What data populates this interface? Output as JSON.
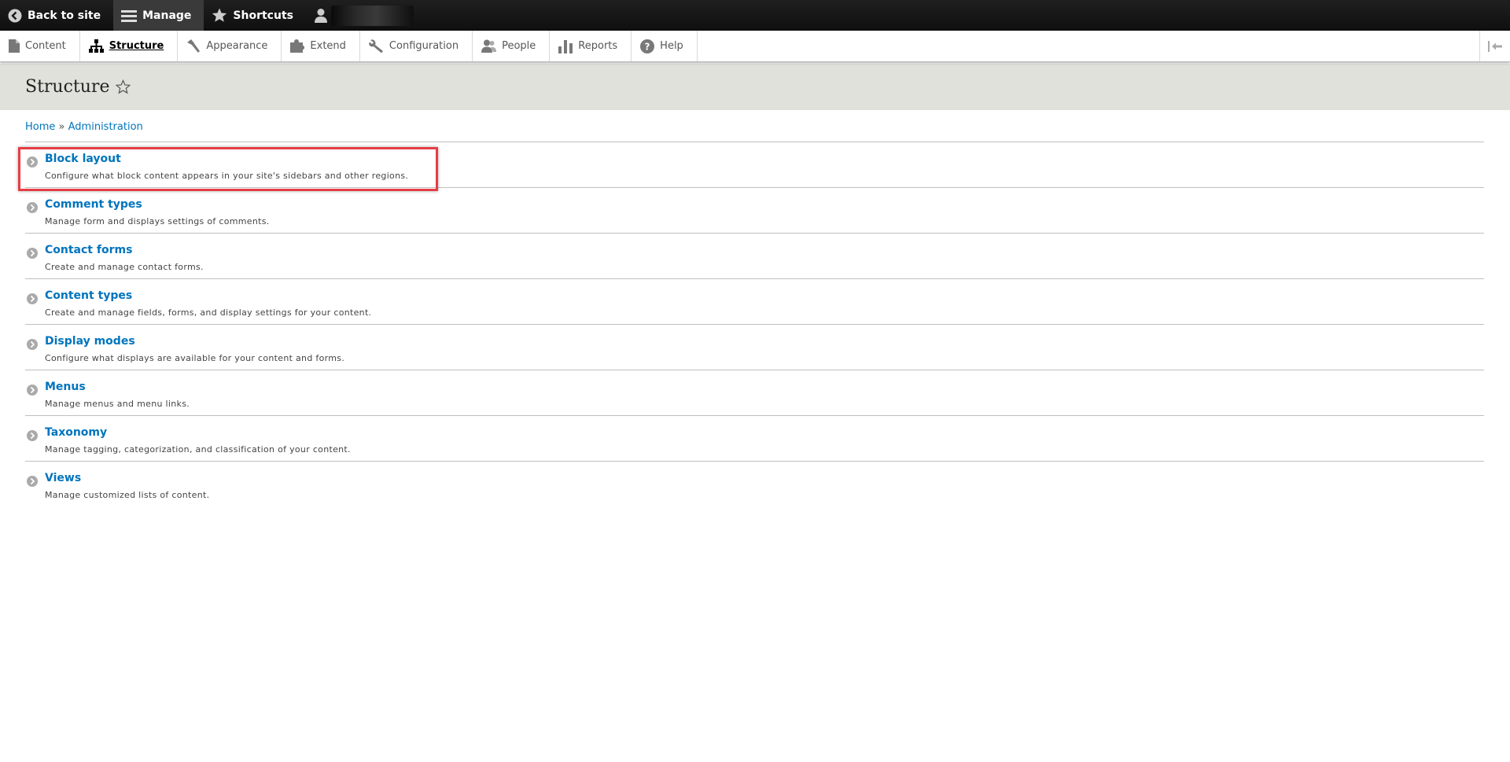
{
  "toolbar": {
    "back_label": "Back to site",
    "manage_label": "Manage",
    "shortcuts_label": "Shortcuts"
  },
  "tray": {
    "items": [
      {
        "label": "Content",
        "icon": "document-icon"
      },
      {
        "label": "Structure",
        "icon": "sitemap-icon"
      },
      {
        "label": "Appearance",
        "icon": "paintbrush-icon"
      },
      {
        "label": "Extend",
        "icon": "puzzle-icon"
      },
      {
        "label": "Configuration",
        "icon": "wrench-icon"
      },
      {
        "label": "People",
        "icon": "people-icon"
      },
      {
        "label": "Reports",
        "icon": "bar-chart-icon"
      },
      {
        "label": "Help",
        "icon": "help-icon"
      }
    ],
    "active": "Structure"
  },
  "page": {
    "title": "Structure"
  },
  "breadcrumb": {
    "home": "Home",
    "separator": "»",
    "admin": "Administration"
  },
  "admin_items": [
    {
      "title": "Block layout",
      "description": "Configure what block content appears in your site's sidebars and other regions."
    },
    {
      "title": "Comment types",
      "description": "Manage form and displays settings of comments."
    },
    {
      "title": "Contact forms",
      "description": "Create and manage contact forms."
    },
    {
      "title": "Content types",
      "description": "Create and manage fields, forms, and display settings for your content."
    },
    {
      "title": "Display modes",
      "description": "Configure what displays are available for your content and forms."
    },
    {
      "title": "Menus",
      "description": "Manage menus and menu links."
    },
    {
      "title": "Taxonomy",
      "description": "Manage tagging, categorization, and classification of your content."
    },
    {
      "title": "Views",
      "description": "Manage customized lists of content."
    }
  ],
  "colors": {
    "link": "#0074bd",
    "highlight": "#e53d45",
    "title_bg": "#e1e1dc"
  }
}
